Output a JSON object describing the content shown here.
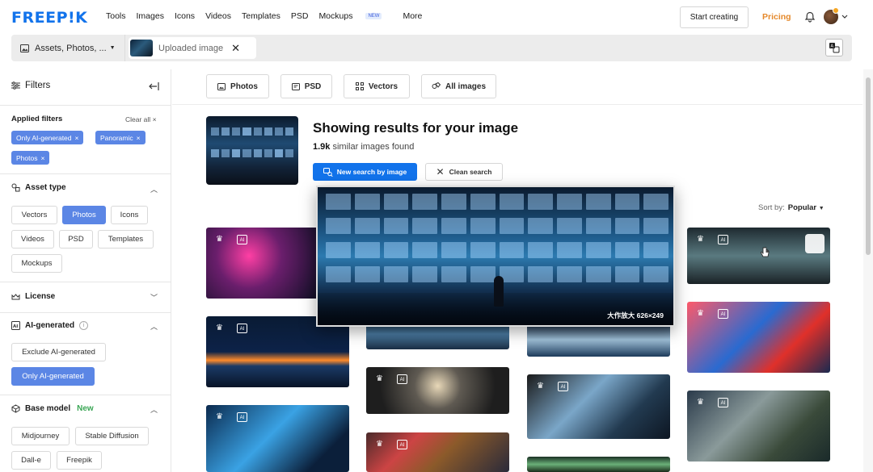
{
  "header": {
    "logo": "FREEP!K",
    "nav": [
      {
        "label": "Tools"
      },
      {
        "label": "Images"
      },
      {
        "label": "Icons"
      },
      {
        "label": "Videos"
      },
      {
        "label": "Templates"
      },
      {
        "label": "PSD"
      },
      {
        "label": "Mockups",
        "badge": "NEW"
      },
      {
        "label": "More"
      }
    ],
    "start_creating": "Start creating",
    "pricing": "Pricing"
  },
  "search": {
    "scope": "Assets, Photos, ...",
    "uploaded_chip": "Uploaded image",
    "close": "✕"
  },
  "sidebar": {
    "title": "Filters",
    "applied_title": "Applied filters",
    "clear_all": "Clear all",
    "applied": [
      "Only AI-generated",
      "Panoramic",
      "Photos"
    ],
    "asset_type": {
      "title": "Asset type",
      "options": [
        "Vectors",
        "Photos",
        "Icons",
        "Videos",
        "PSD",
        "Templates",
        "Mockups"
      ],
      "selected": "Photos"
    },
    "license": {
      "title": "License"
    },
    "ai_generated": {
      "title": "AI-generated",
      "options": [
        "Exclude AI-generated",
        "Only AI-generated"
      ],
      "selected": "Only AI-generated"
    },
    "base_model": {
      "title": "Base model",
      "badge": "New",
      "options": [
        "Midjourney",
        "Stable Diffusion",
        "Dall-e",
        "Freepik"
      ]
    }
  },
  "tabs": [
    {
      "label": "Photos"
    },
    {
      "label": "PSD"
    },
    {
      "label": "Vectors"
    },
    {
      "label": "All images"
    }
  ],
  "results": {
    "title": "Showing results for your image",
    "count": "1.9k",
    "count_suffix": "similar images found",
    "new_search": "New search by image",
    "clean_search": "Clean search",
    "sort_label": "Sort by:",
    "sort_value": "Popular"
  },
  "preview": {
    "caption": "大作放大 626×249"
  },
  "colors": {
    "brand": "#1273eb",
    "pricing": "#e5892b",
    "filter_chip": "#5b86e5"
  }
}
